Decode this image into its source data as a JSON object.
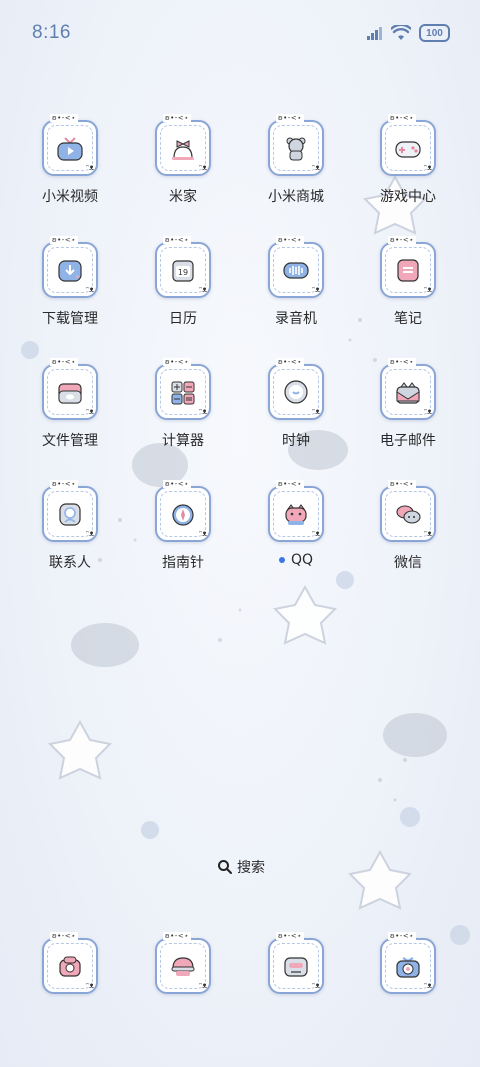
{
  "status_bar": {
    "time": "8:16",
    "battery_level": "100"
  },
  "apps": [
    {
      "label": "小米视频",
      "icon": "tv-play-icon"
    },
    {
      "label": "米家",
      "icon": "bell-bow-icon"
    },
    {
      "label": "小米商城",
      "icon": "bear-bag-icon"
    },
    {
      "label": "游戏中心",
      "icon": "gamepad-icon"
    },
    {
      "label": "下载管理",
      "icon": "download-icon"
    },
    {
      "label": "日历",
      "icon": "calendar-icon"
    },
    {
      "label": "录音机",
      "icon": "recorder-icon"
    },
    {
      "label": "笔记",
      "icon": "notes-icon"
    },
    {
      "label": "文件管理",
      "icon": "folder-icon"
    },
    {
      "label": "计算器",
      "icon": "calculator-icon"
    },
    {
      "label": "时钟",
      "icon": "clock-icon"
    },
    {
      "label": "电子邮件",
      "icon": "email-icon"
    },
    {
      "label": "联系人",
      "icon": "contacts-icon"
    },
    {
      "label": "指南针",
      "icon": "compass-icon"
    },
    {
      "label": "QQ",
      "icon": "qq-icon",
      "has_update_dot": true
    },
    {
      "label": "微信",
      "icon": "wechat-icon"
    }
  ],
  "search": {
    "label": "搜索"
  },
  "dock": [
    {
      "icon": "phone-icon"
    },
    {
      "icon": "messages-icon"
    },
    {
      "icon": "browser-icon"
    },
    {
      "icon": "camera-icon"
    }
  ],
  "frame_decoration": {
    "top": "ʚ•-<⋆",
    "corner": "ᵔᴥ"
  },
  "colors": {
    "accent": "#5f7fb0",
    "frame": "#8aa6d6",
    "pink": "#f0a7b8",
    "blue": "#7fa5dd"
  }
}
